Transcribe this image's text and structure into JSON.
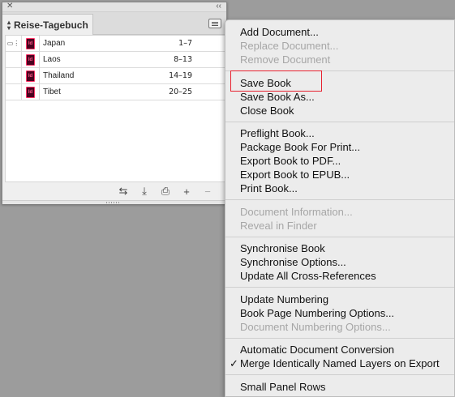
{
  "panel": {
    "close_glyph": "✕",
    "collapse_glyph": "‹‹",
    "title": "Reise-Tagebuch",
    "books": [
      {
        "name": "Japan",
        "pages": "1–7"
      },
      {
        "name": "Laos",
        "pages": "8–13"
      },
      {
        "name": "Thailand",
        "pages": "14–19"
      },
      {
        "name": "Tibet",
        "pages": "20–25"
      }
    ],
    "toolbar": {
      "sync": "⇆",
      "save": "⤓",
      "print": "⎙",
      "add": "+",
      "remove": "−"
    }
  },
  "menu": {
    "items": [
      {
        "label": "Add Document...",
        "enabled": true
      },
      {
        "label": "Replace Document...",
        "enabled": false
      },
      {
        "label": "Remove Document",
        "enabled": false
      },
      {
        "label": "Save Book",
        "enabled": true
      },
      {
        "label": "Save Book As...",
        "enabled": true
      },
      {
        "label": "Close Book",
        "enabled": true
      },
      {
        "label": "Preflight Book...",
        "enabled": true
      },
      {
        "label": "Package Book For Print...",
        "enabled": true
      },
      {
        "label": "Export Book to PDF...",
        "enabled": true
      },
      {
        "label": "Export Book to EPUB...",
        "enabled": true
      },
      {
        "label": "Print Book...",
        "enabled": true
      },
      {
        "label": "Document Information...",
        "enabled": false
      },
      {
        "label": "Reveal in Finder",
        "enabled": false
      },
      {
        "label": "Synchronise Book",
        "enabled": true
      },
      {
        "label": "Synchronise Options...",
        "enabled": true
      },
      {
        "label": "Update All Cross-References",
        "enabled": true
      },
      {
        "label": "Update Numbering",
        "enabled": true,
        "submenu": "▶"
      },
      {
        "label": "Book Page Numbering Options...",
        "enabled": true
      },
      {
        "label": "Document Numbering Options...",
        "enabled": false
      },
      {
        "label": "Automatic Document Conversion",
        "enabled": true
      },
      {
        "label": "Merge Identically Named Layers on Export",
        "enabled": true,
        "checked": "✓"
      },
      {
        "label": "Small Panel Rows",
        "enabled": true
      }
    ],
    "highlighted_item": "Save Book",
    "highlight_color": "#e8212f"
  }
}
